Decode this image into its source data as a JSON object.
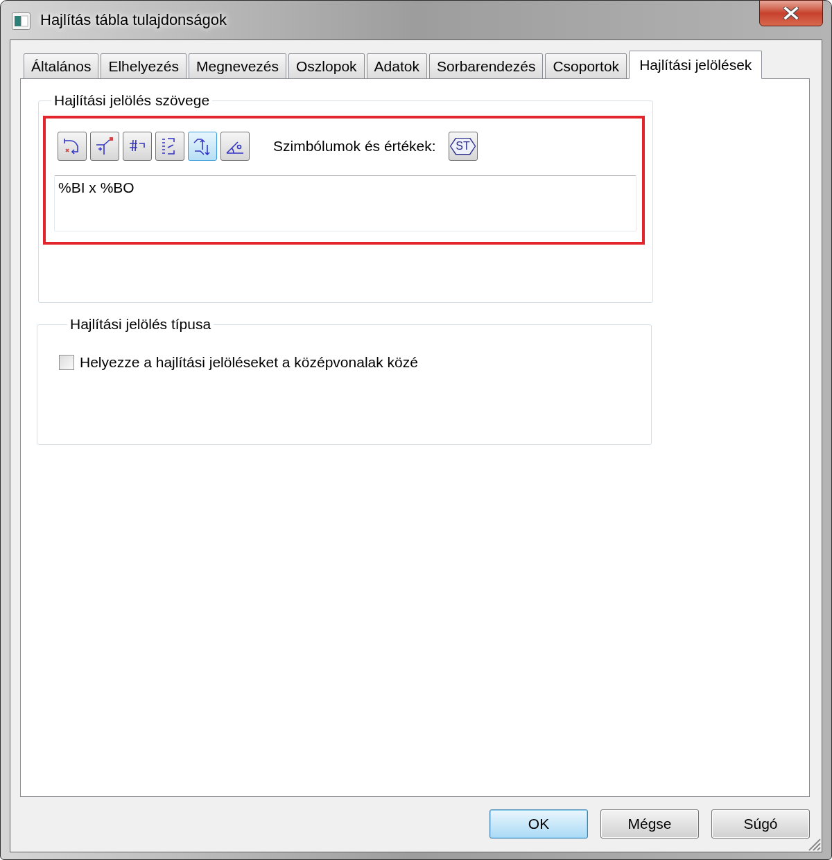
{
  "window": {
    "title": "Hajlítás tábla tulajdonságok"
  },
  "tabs": [
    {
      "label": "Általános",
      "selected": false
    },
    {
      "label": "Elhelyezés",
      "selected": false
    },
    {
      "label": "Megnevezés",
      "selected": false
    },
    {
      "label": "Oszlopok",
      "selected": false
    },
    {
      "label": "Adatok",
      "selected": false
    },
    {
      "label": "Sorbarendezés",
      "selected": false
    },
    {
      "label": "Csoportok",
      "selected": false
    },
    {
      "label": "Hajlítási jelölések",
      "selected": true
    }
  ],
  "text_group": {
    "title": "Hajlítási jelölés szövege",
    "tools": [
      {
        "kind": "corner",
        "selected": false
      },
      {
        "kind": "branch",
        "selected": false
      },
      {
        "kind": "hash",
        "selected": false
      },
      {
        "kind": "steps",
        "selected": false
      },
      {
        "kind": "arrows",
        "selected": true
      },
      {
        "kind": "angle",
        "selected": false
      }
    ],
    "symbols_label": "Szimbólumok és értékek:",
    "symbols_button": "ST",
    "text": "%BI x %BO"
  },
  "type_group": {
    "title": "Hajlítási jelölés típusa",
    "checkbox": {
      "label": "Helyezze a hajlítási jelöléseket a középvonalak közé",
      "checked": false
    }
  },
  "buttons": [
    {
      "label": "OK",
      "default": true
    },
    {
      "label": "Mégse",
      "default": false
    },
    {
      "label": "Súgó",
      "default": false
    }
  ]
}
